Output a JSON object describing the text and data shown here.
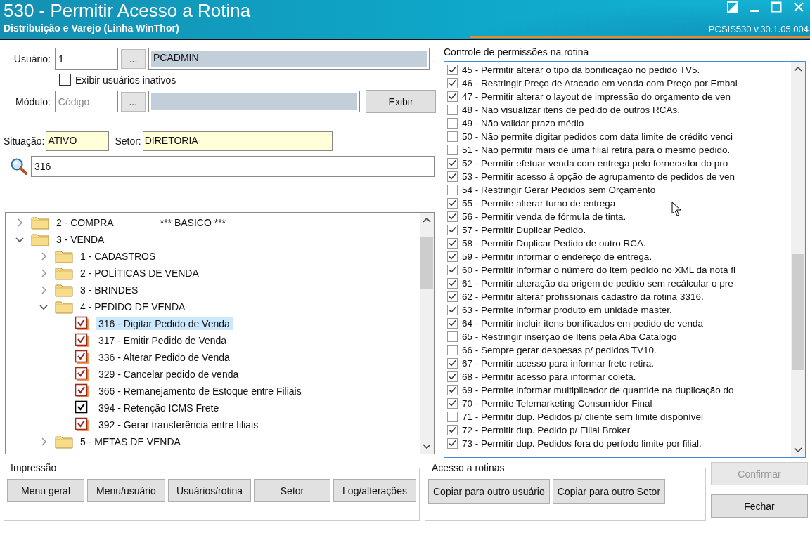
{
  "window": {
    "title": "530 - Permitir Acesso a Rotina",
    "subtitle": "Distribuição e Varejo (Linha WinThor)",
    "version": "PCSIS530  v.30.1.05.004"
  },
  "user": {
    "label": "Usuário:",
    "code": "1",
    "lookup": "...",
    "name": "PCADMIN"
  },
  "show_inactive": {
    "label": "Exibir usuários inativos",
    "checked": false
  },
  "module": {
    "label": "Módulo:",
    "placeholder": "Código",
    "lookup": "...",
    "button": "Exibir"
  },
  "status": {
    "label": "Situação:",
    "value": "ATIVO"
  },
  "sector": {
    "label": "Setor:",
    "value": "DIRETORIA"
  },
  "search": {
    "value": "316"
  },
  "tree": [
    {
      "kind": "folder",
      "label": "2 - COMPRA",
      "note": "*** BASICO ***",
      "expanded": false
    },
    {
      "kind": "folder",
      "label": "3 - VENDA",
      "expanded": true,
      "children": [
        {
          "kind": "folder",
          "label": "1 - CADASTROS",
          "expanded": false
        },
        {
          "kind": "folder",
          "label": "2 - POLÍTICAS DE VENDA",
          "expanded": false
        },
        {
          "kind": "folder",
          "label": "3 - BRINDES",
          "expanded": false
        },
        {
          "kind": "folder",
          "label": "4 - PEDIDO DE VENDA",
          "expanded": true,
          "children": [
            {
              "kind": "routine",
              "label": "316 - Digitar Pedido de Venda",
              "checked": true,
              "color": "#9c2a22",
              "selected": true
            },
            {
              "kind": "routine",
              "label": "317 - Emitir Pedido de Venda",
              "checked": true,
              "color": "#9c2a22",
              "selected": false
            },
            {
              "kind": "routine",
              "label": "336 - Alterar Pedido de Venda",
              "checked": true,
              "color": "#9c2a22",
              "selected": false
            },
            {
              "kind": "routine",
              "label": "329 - Cancelar pedido de venda",
              "checked": true,
              "color": "#9c2a22",
              "selected": false
            },
            {
              "kind": "routine",
              "label": "366 - Remanejamento de Estoque entre Filiais",
              "checked": true,
              "color": "#9c2a22",
              "selected": false
            },
            {
              "kind": "routine",
              "label": "394 - Retenção ICMS Frete",
              "checked": true,
              "color": "#000000",
              "selected": false
            },
            {
              "kind": "routine",
              "label": "392 - Gerar transferência entre filiais",
              "checked": true,
              "color": "#9c2a22",
              "selected": false
            }
          ]
        },
        {
          "kind": "folder",
          "label": "5 - METAS DE VENDA",
          "expanded": false
        }
      ]
    }
  ],
  "permissions": {
    "title": "Controle de permissões na rotina",
    "items": [
      {
        "label": "45 - Permitir alterar o tipo da bonificação no pedido TV5.",
        "checked": true
      },
      {
        "label": "46 - Restringir Preço de Atacado em venda com Preço por Embal",
        "checked": true
      },
      {
        "label": "47 - Permitir alterar o layout de impressão do orçamento de ven",
        "checked": true
      },
      {
        "label": "48 - Não visualizar itens de pedido de outros RCAs.",
        "checked": false
      },
      {
        "label": "49 - Não validar prazo médio",
        "checked": false
      },
      {
        "label": "50 - Não permite digitar pedidos com data limite de crédito venci",
        "checked": false
      },
      {
        "label": "51 - Não permitir mais de uma filial retira para o mesmo pedido.",
        "checked": false
      },
      {
        "label": "52 - Permitir efetuar venda com entrega pelo fornecedor do pro",
        "checked": true
      },
      {
        "label": "53 - Permitir acesso á opção de agrupamento de pedidos de ven",
        "checked": true
      },
      {
        "label": "54 - Restringir Gerar Pedidos sem Orçamento",
        "checked": false
      },
      {
        "label": "55 - Permite alterar turno de entrega",
        "checked": true
      },
      {
        "label": "56 - Permitir venda de fórmula de tinta.",
        "checked": true
      },
      {
        "label": "57 - Permitir Duplicar Pedido.",
        "checked": true
      },
      {
        "label": "58 - Permitir Duplicar Pedido de outro RCA.",
        "checked": true
      },
      {
        "label": "59 - Permitir informar o endereço de entrega.",
        "checked": true
      },
      {
        "label": "60 - Permitir informar o número do item pedido no XML da nota fi",
        "checked": true
      },
      {
        "label": "61 - Permitir alteração da origem de pedido sem recálcular o pre",
        "checked": true
      },
      {
        "label": "62 - Permitir alterar profissionais cadastro da rotina 3316.",
        "checked": true
      },
      {
        "label": "63 - Permite informar produto em unidade master.",
        "checked": true
      },
      {
        "label": "64 - Permitir incluir itens bonificados em pedido de venda",
        "checked": true
      },
      {
        "label": "65 - Restringir inserção de Itens pela Aba Catalogo",
        "checked": false
      },
      {
        "label": "66 - Sempre gerar despesas p/ pedidos TV10.",
        "checked": false
      },
      {
        "label": "67 - Permitir acesso para informar frete retira.",
        "checked": true
      },
      {
        "label": "68 - Permitir acesso para informar coleta.",
        "checked": true
      },
      {
        "label": "69 - Permite informar multiplicador de quantide na duplicação do",
        "checked": true
      },
      {
        "label": "70 - Permite Telemarketing Consumidor Final",
        "checked": true
      },
      {
        "label": "71 - Permitir dup. Pedidos p/ cliente sem limite disponível",
        "checked": false
      },
      {
        "label": "72 - Permitir dup. Pedido p/ Filial Broker",
        "checked": true
      },
      {
        "label": "73 - Permitir dup. Pedidos fora do período limite por filial.",
        "checked": true
      }
    ]
  },
  "printing": {
    "title": "Impressão",
    "buttons": [
      "Menu geral",
      "Menu/usuário",
      "Usuários/rotina",
      "Setor",
      "Log/alterações"
    ]
  },
  "access": {
    "title": "Acesso a rotinas",
    "buttons": [
      "Copiar para outro usuário",
      "Copiar para outro Setor"
    ]
  },
  "actions": [
    {
      "label": "Confirmar",
      "disabled": true
    },
    {
      "label": "Fechar",
      "disabled": false
    }
  ]
}
